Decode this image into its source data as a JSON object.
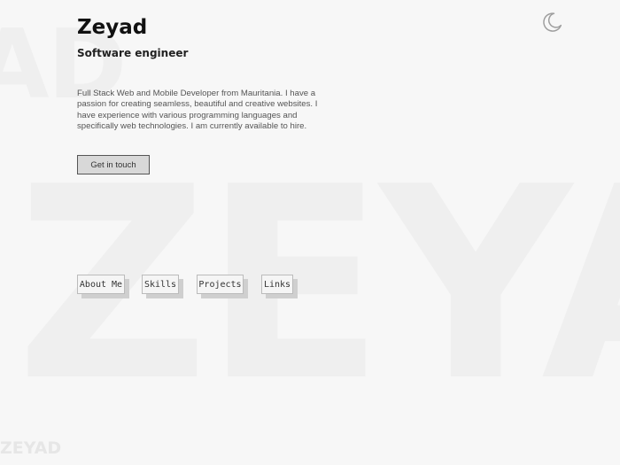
{
  "background": {
    "top_fragment": "AD",
    "big_text": "ZEYAD",
    "footer_text": "ZEYAD"
  },
  "theme_toggle": {
    "icon": "moon-icon",
    "color": "#9e9e9e"
  },
  "header": {
    "name": "Zeyad",
    "role": "Software engineer",
    "bio": "Full Stack Web and Mobile Developer from Mauritania. I have a passion for creating seamless, beautiful and creative websites. I have experience with various programming languages and specifically web technologies. I am currently available to hire."
  },
  "cta": {
    "label": "Get in touch"
  },
  "nav": {
    "items": [
      {
        "label": "About Me"
      },
      {
        "label": "Skills"
      },
      {
        "label": "Projects"
      },
      {
        "label": "Links"
      }
    ]
  },
  "colors": {
    "background": "#f7f7f7",
    "watermark": "#efefef",
    "text": "#111111",
    "button_bg": "#d8d8d8",
    "button_shadow": "#cfcfcf"
  }
}
